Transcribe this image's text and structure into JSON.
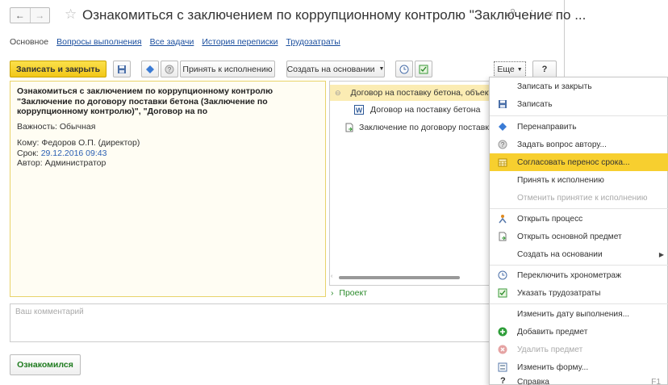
{
  "window": {
    "title": "Ознакомиться с заключением по коррупционному контролю \"Заключение по ..."
  },
  "tabs": [
    {
      "label": "Основное"
    },
    {
      "label": "Вопросы выполнения"
    },
    {
      "label": "Все задачи"
    },
    {
      "label": "История переписки"
    },
    {
      "label": "Трудозатраты"
    }
  ],
  "toolbar": {
    "save_close_label": "Записать и закрыть",
    "accept_label": "Принять к исполнению",
    "create_based_label": "Создать на основании",
    "more_label": "Еще",
    "help_label": "?"
  },
  "task": {
    "subject": "Ознакомиться с заключением по коррупционному контролю \"Заключение по договору поставки бетона (Заключение по коррупционному контролю)\", \"Договор на по",
    "importance_label": "Важность:",
    "importance_value": "Обычная",
    "to_label": "Кому:",
    "to_value": "Федоров О.П. (директор)",
    "deadline_label": "Срок:",
    "deadline_value": "29.12.2016 09:43",
    "author_label": "Автор:",
    "author_value": "Администратор"
  },
  "attachments": [
    {
      "label": "Договор на поставку бетона, объект",
      "icon": "document-icon"
    },
    {
      "label": "Договор на поставку бетона",
      "icon": "word-icon"
    },
    {
      "label": "Заключение по договору поставки бе",
      "icon": "conclusion-icon"
    }
  ],
  "project_label": "Проект",
  "comment_placeholder": "Ваш комментарий",
  "ack_button_label": "Ознакомился",
  "menu": {
    "items": [
      {
        "label": "Записать и закрыть",
        "icon": "",
        "disabled": false
      },
      {
        "label": "Записать",
        "icon": "save-icon",
        "disabled": false
      },
      {
        "label": "Перенаправить",
        "icon": "redirect-icon",
        "disabled": false
      },
      {
        "label": "Задать вопрос автору...",
        "icon": "question-icon",
        "disabled": false
      },
      {
        "label": "Согласовать перенос срока...",
        "icon": "calendar-icon",
        "disabled": false,
        "highlighted": true
      },
      {
        "label": "Принять к исполнению",
        "icon": "",
        "disabled": false
      },
      {
        "label": "Отменить принятие к исполнению",
        "icon": "",
        "disabled": true
      },
      {
        "label": "Открыть процесс",
        "icon": "process-icon",
        "disabled": false
      },
      {
        "label": "Открыть основной предмет",
        "icon": "open-subject-icon",
        "disabled": false
      },
      {
        "label": "Создать на основании",
        "icon": "",
        "disabled": false,
        "submenu": true
      },
      {
        "label": "Переключить хронометраж",
        "icon": "clock-icon",
        "disabled": false
      },
      {
        "label": "Указать трудозатраты",
        "icon": "labor-icon",
        "disabled": false
      },
      {
        "label": "Изменить дату выполнения...",
        "icon": "",
        "disabled": false
      },
      {
        "label": "Добавить предмет",
        "icon": "add-icon",
        "disabled": false
      },
      {
        "label": "Удалить предмет",
        "icon": "remove-icon",
        "disabled": true
      },
      {
        "label": "Изменить форму...",
        "icon": "form-icon",
        "disabled": false
      },
      {
        "label": "Справка",
        "icon": "help-icon",
        "disabled": false,
        "shortcut": "F1"
      }
    ]
  },
  "colors": {
    "accent_yellow": "#f7cf2f",
    "link_blue": "#1a4e9e",
    "green": "#1d7a1d"
  }
}
